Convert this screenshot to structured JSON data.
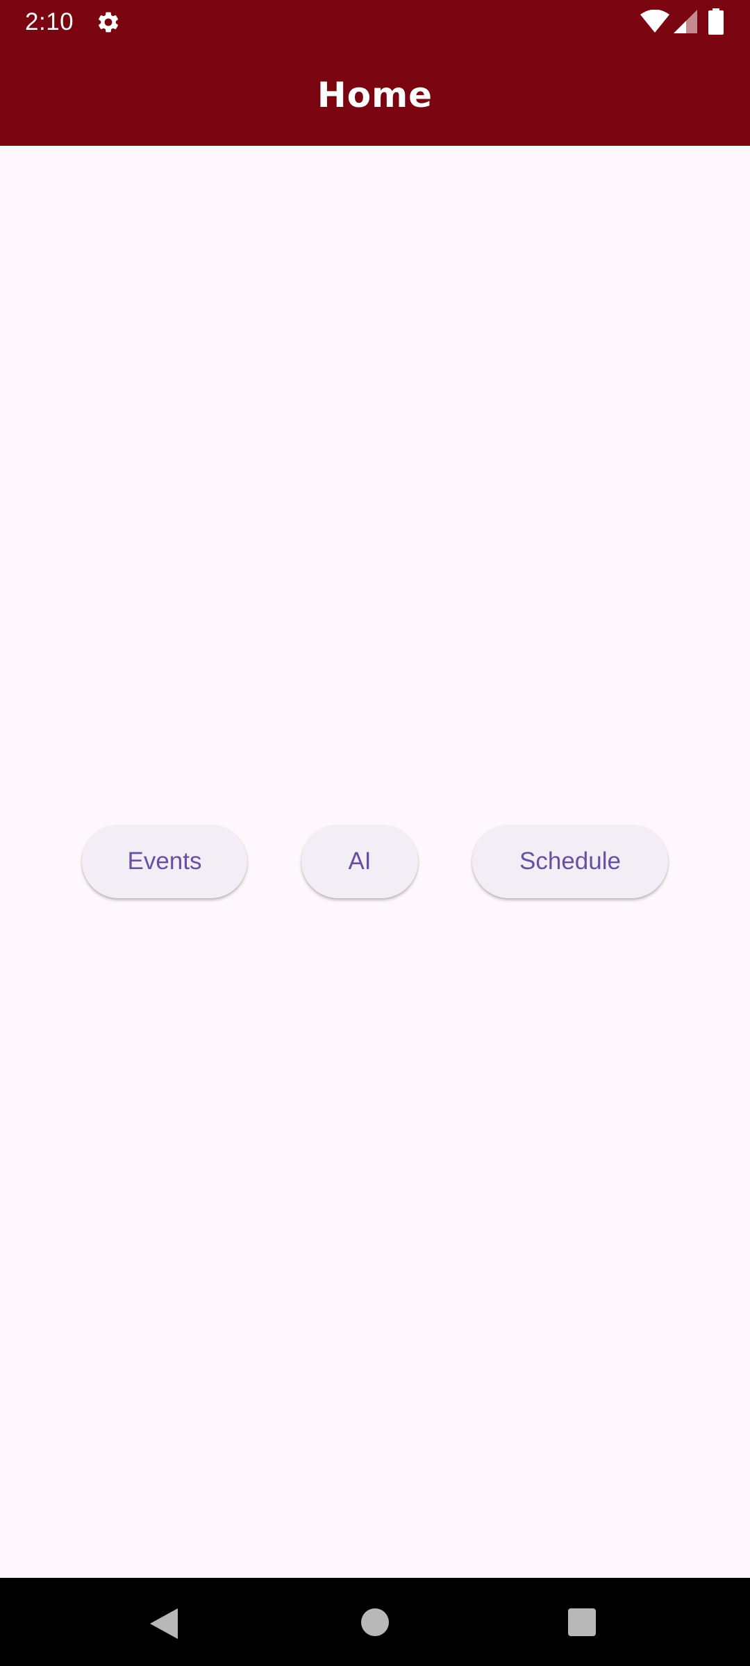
{
  "status_bar": {
    "time": "2:10",
    "icons": [
      "gear-icon",
      "wifi-icon",
      "cell-signal-icon",
      "battery-icon"
    ]
  },
  "app_bar": {
    "title": "Home",
    "background_color": "#7a0510",
    "title_color": "#ffffff"
  },
  "main": {
    "buttons": [
      {
        "label": "Events"
      },
      {
        "label": "AI"
      },
      {
        "label": "Schedule"
      }
    ],
    "button_text_color": "#6750a4",
    "button_background": "#f3eef6",
    "background_color": "#fef8fc"
  },
  "nav_bar": {
    "icons": [
      "back-icon",
      "home-icon",
      "recents-icon"
    ]
  }
}
